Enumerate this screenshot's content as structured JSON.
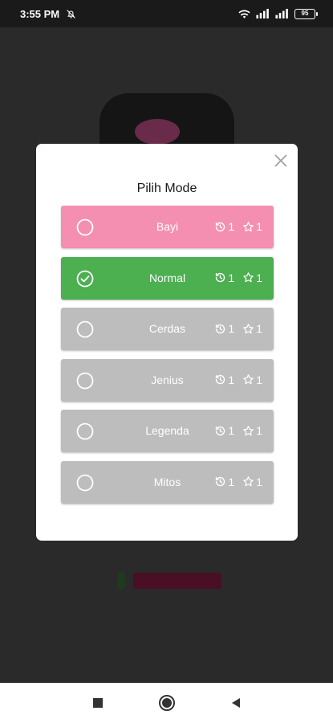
{
  "status_bar": {
    "time": "3:55 PM",
    "battery": "95"
  },
  "modal": {
    "title": "Pilih Mode",
    "modes": [
      {
        "label": "Bayi",
        "history": "1",
        "stars": "1",
        "color": "#f48fb1",
        "selected": false
      },
      {
        "label": "Normal",
        "history": "1",
        "stars": "1",
        "color": "#4caf50",
        "selected": true
      },
      {
        "label": "Cerdas",
        "history": "1",
        "stars": "1",
        "color": "#bdbdbd",
        "selected": false
      },
      {
        "label": "Jenius",
        "history": "1",
        "stars": "1",
        "color": "#bdbdbd",
        "selected": false
      },
      {
        "label": "Legenda",
        "history": "1",
        "stars": "1",
        "color": "#bdbdbd",
        "selected": false
      },
      {
        "label": "Mitos",
        "history": "1",
        "stars": "1",
        "color": "#bdbdbd",
        "selected": false
      }
    ]
  },
  "icons": {
    "close": "close-icon",
    "history": "history-icon",
    "star": "star-outline-icon",
    "radio_off": "radio-unchecked-icon",
    "radio_on": "check-circle-icon",
    "nav": [
      "recents-square-icon",
      "home-circle-icon",
      "back-triangle-icon"
    ]
  }
}
